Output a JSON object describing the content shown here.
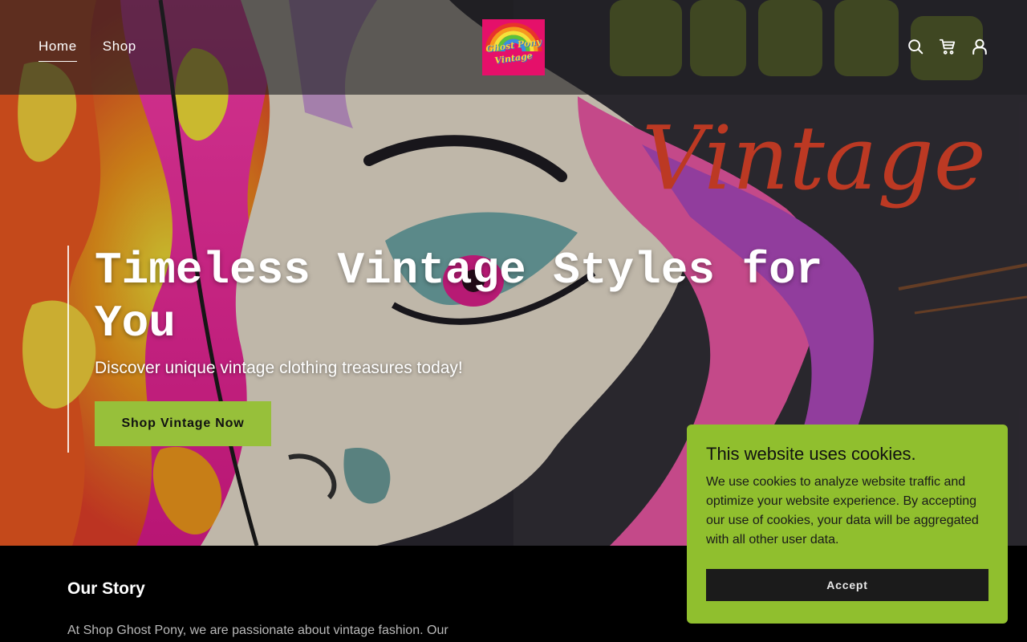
{
  "nav": {
    "items": [
      {
        "label": "Home",
        "active": true
      },
      {
        "label": "Shop",
        "active": false
      }
    ]
  },
  "logo": {
    "line1": "Ghost Pony",
    "line2": "Vintage",
    "bg_color": "#e5106a"
  },
  "header_icons": [
    "search-icon",
    "cart-icon",
    "account-icon"
  ],
  "hero": {
    "title": "Timeless Vintage Styles for You",
    "subtitle": "Discover unique vintage clothing treasures today!",
    "cta_label": "Shop Vintage Now",
    "cta_color": "#97c03a",
    "art_text": "Vintage"
  },
  "story": {
    "title": "Our Story",
    "text": "At Shop Ghost Pony, we are passionate about vintage fashion. Our"
  },
  "cookie_banner": {
    "title": "This website uses cookies.",
    "text": "We use cookies to analyze website traffic and optimize your website experience. By accepting our use of cookies, your data will be aggregated with all other user data.",
    "accept_label": "Accept",
    "bg_color": "#90bf2e"
  }
}
